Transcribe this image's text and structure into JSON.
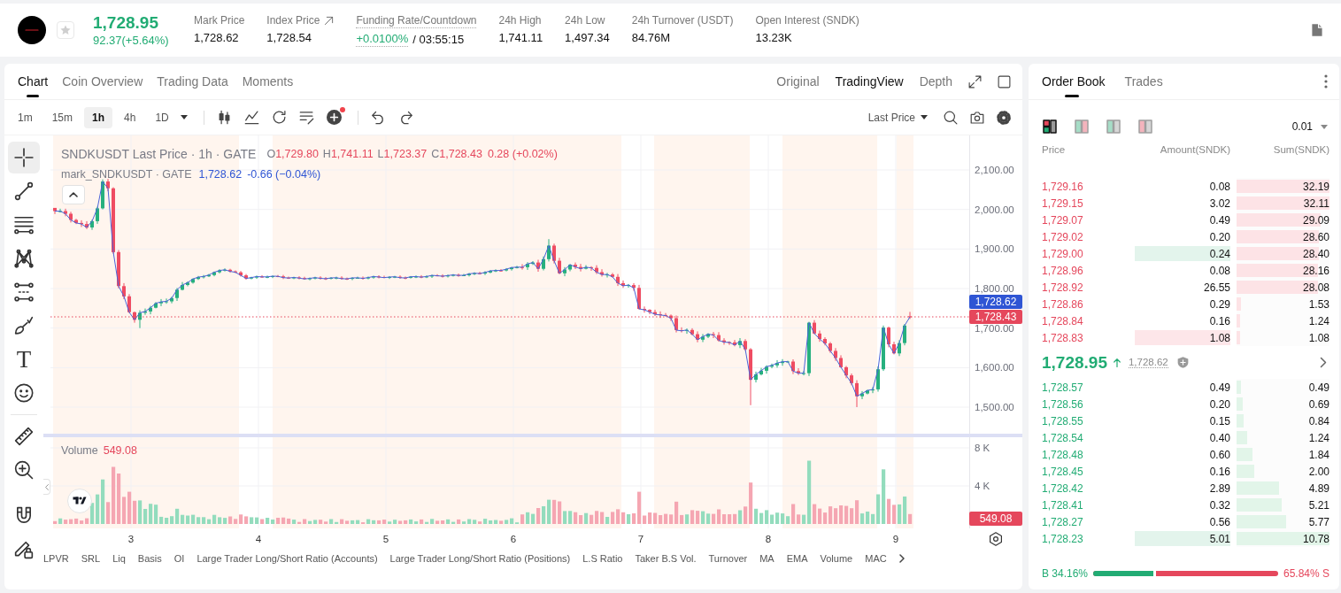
{
  "ticker": {
    "starred": false,
    "rising": true,
    "price": "1,728.95",
    "change": "92.37(+5.64%)",
    "stats": [
      {
        "kind": "plain",
        "label": "Mark Price",
        "value": "1,728.62"
      },
      {
        "kind": "link",
        "label": "Index Price",
        "value": "1,728.54"
      },
      {
        "kind": "funding",
        "label": "Funding Rate/Countdown",
        "value": "+0.0100%",
        "countdown": "/ 03:55:15"
      },
      {
        "kind": "plain",
        "label": "24h High",
        "value": "1,741.11"
      },
      {
        "kind": "plain",
        "label": "24h Low",
        "value": "1,497.34"
      },
      {
        "kind": "plain",
        "label": "24h Turnover (USDT)",
        "value": "84.76M"
      },
      {
        "kind": "plain",
        "label": "Open Interest (SNDK)",
        "value": "13.23K"
      }
    ]
  },
  "chart": {
    "tabs": [
      {
        "label": "Chart",
        "selected": true
      },
      {
        "label": "Coin Overview",
        "selected": false
      },
      {
        "label": "Trading Data",
        "selected": false
      },
      {
        "label": "Moments",
        "selected": false
      }
    ],
    "views": [
      {
        "label": "Original",
        "selected": false
      },
      {
        "label": "TradingView",
        "selected": true
      },
      {
        "label": "Depth",
        "selected": false
      }
    ],
    "intervals": [
      {
        "label": "1m",
        "selected": false
      },
      {
        "label": "15m",
        "selected": false
      },
      {
        "label": "1h",
        "selected": true
      },
      {
        "label": "4h",
        "selected": false
      },
      {
        "label": "1D",
        "selected": false
      }
    ],
    "price_source": "Last Price",
    "drawing_tools": [
      {
        "selected": true
      },
      {
        "selected": false
      },
      {
        "selected": false
      },
      {
        "selected": false
      },
      {
        "selected": false
      },
      {
        "selected": false
      },
      {
        "selected": false,
        "label": "T"
      },
      {
        "selected": false
      },
      {
        "selected": false
      },
      {
        "selected": false
      },
      {
        "selected": false
      },
      {
        "selected": false
      }
    ],
    "legend": {
      "rising": false,
      "symbol": "SNDKUSDT Last Price · 1h · GATE",
      "ohlc": [
        {
          "key": "O",
          "value": "1,729.80"
        },
        {
          "key": "H",
          "value": "1,741.11"
        },
        {
          "key": "L",
          "value": "1,723.37"
        },
        {
          "key": "C",
          "value": "1,728.43"
        }
      ],
      "change": "0.28 (+0.02%)"
    },
    "mark_legend": {
      "symbol": "mark_SNDKUSDT · GATE",
      "value": "1,728.62",
      "change": "-0.66 (−0.04%)"
    },
    "price_axis": [
      "2,100.00",
      "2,000.00",
      "1,900.00",
      "1,800.00",
      "1,700.00",
      "1,600.00",
      "1,500.00"
    ],
    "price_labels": [
      {
        "text": "1,728.62",
        "color": "#2f55d4"
      },
      {
        "text": "1,728.43",
        "color": "#e5475c"
      }
    ],
    "volume": {
      "title": "Volume",
      "value": "549.08",
      "axis": [
        "8 K",
        "4 K"
      ],
      "label": "549.08"
    },
    "time_axis": [
      "3",
      "4",
      "5",
      "6",
      "7",
      "8",
      "9"
    ],
    "indicators": [
      "LPVR",
      "SRL",
      "Liq",
      "Basis",
      "OI",
      "Large Trader Long/Short Ratio (Accounts)",
      "Large Trader Long/Short Ratio (Positions)",
      "L.S Ratio",
      "Taker B.S Vol.",
      "Turnover",
      "MA",
      "EMA",
      "Volume",
      "MAC"
    ]
  },
  "order_book": {
    "tabs": [
      {
        "label": "Order Book",
        "selected": true
      },
      {
        "label": "Trades",
        "selected": false
      }
    ],
    "view_modes": [
      {
        "selected": true
      },
      {
        "selected": false
      },
      {
        "selected": false
      },
      {
        "selected": false
      }
    ],
    "precision": "0.01",
    "columns": [
      "Price",
      "Amount(SNDK)",
      "Sum(SNDK)"
    ],
    "asks": [
      {
        "price": "1,729.16",
        "amount": "0.08",
        "sum": "32.19",
        "level": 1,
        "highlighted": false
      },
      {
        "price": "1,729.15",
        "amount": "3.02",
        "sum": "32.11",
        "level": 0.998,
        "highlighted": false
      },
      {
        "price": "1,729.07",
        "amount": "0.49",
        "sum": "29.09",
        "level": 0.904,
        "highlighted": false
      },
      {
        "price": "1,729.02",
        "amount": "0.20",
        "sum": "28.60",
        "level": 0.888,
        "highlighted": false
      },
      {
        "price": "1,729.00",
        "amount": "0.24",
        "sum": "28.40",
        "level": 0.882,
        "highlighted": true,
        "color": "#e3f4ec"
      },
      {
        "price": "1,728.96",
        "amount": "0.08",
        "sum": "28.16",
        "level": 0.875,
        "highlighted": false
      },
      {
        "price": "1,728.92",
        "amount": "26.55",
        "sum": "28.08",
        "level": 0.872,
        "highlighted": false
      },
      {
        "price": "1,728.86",
        "amount": "0.29",
        "sum": "1.53",
        "level": 0.048,
        "highlighted": false
      },
      {
        "price": "1,728.84",
        "amount": "0.16",
        "sum": "1.24",
        "level": 0.039,
        "highlighted": false
      },
      {
        "price": "1,728.83",
        "amount": "1.08",
        "sum": "1.08",
        "level": 0.034,
        "highlighted": true,
        "color": "#fde6e9"
      }
    ],
    "last": {
      "rising": true,
      "price": "1,728.95",
      "mark": "1,728.62"
    },
    "bids": [
      {
        "price": "1,728.57",
        "amount": "0.49",
        "sum": "0.49",
        "level": 0.045,
        "highlighted": false
      },
      {
        "price": "1,728.56",
        "amount": "0.20",
        "sum": "0.69",
        "level": 0.064,
        "highlighted": false
      },
      {
        "price": "1,728.55",
        "amount": "0.15",
        "sum": "0.84",
        "level": 0.078,
        "highlighted": false
      },
      {
        "price": "1,728.54",
        "amount": "0.40",
        "sum": "1.24",
        "level": 0.115,
        "highlighted": false
      },
      {
        "price": "1,728.48",
        "amount": "0.60",
        "sum": "1.84",
        "level": 0.171,
        "highlighted": false
      },
      {
        "price": "1,728.45",
        "amount": "0.16",
        "sum": "2.00",
        "level": 0.186,
        "highlighted": false
      },
      {
        "price": "1,728.42",
        "amount": "2.89",
        "sum": "4.89",
        "level": 0.454,
        "highlighted": false
      },
      {
        "price": "1,728.41",
        "amount": "0.32",
        "sum": "5.21",
        "level": 0.483,
        "highlighted": false
      },
      {
        "price": "1,728.27",
        "amount": "0.56",
        "sum": "5.77",
        "level": 0.535,
        "highlighted": false
      },
      {
        "price": "1,728.23",
        "amount": "5.01",
        "sum": "10.78",
        "level": 1,
        "highlighted": true,
        "color": "#e3f4ec"
      }
    ],
    "ratio": {
      "buy": "B 34.16%",
      "sell": "65.84% S",
      "level": 0.3416
    }
  }
}
